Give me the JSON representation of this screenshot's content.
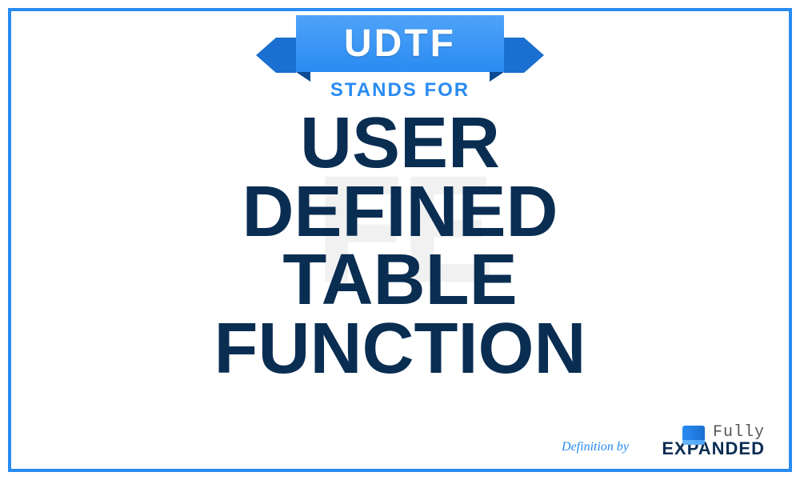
{
  "acronym": "UDTF",
  "stands_for_label": "STANDS FOR",
  "definition": "USER\nDEFINED\nTABLE\nFUNCTION",
  "definition_by_label": "Definition by",
  "brand": {
    "top": "Fully",
    "bottom": "EXPANDED"
  },
  "watermark": "FE",
  "colors": {
    "frame": "#2a8bf2",
    "ribbon": "#2a8bf2",
    "text_dark": "#0a2d52",
    "accent": "#2a8bf2"
  }
}
